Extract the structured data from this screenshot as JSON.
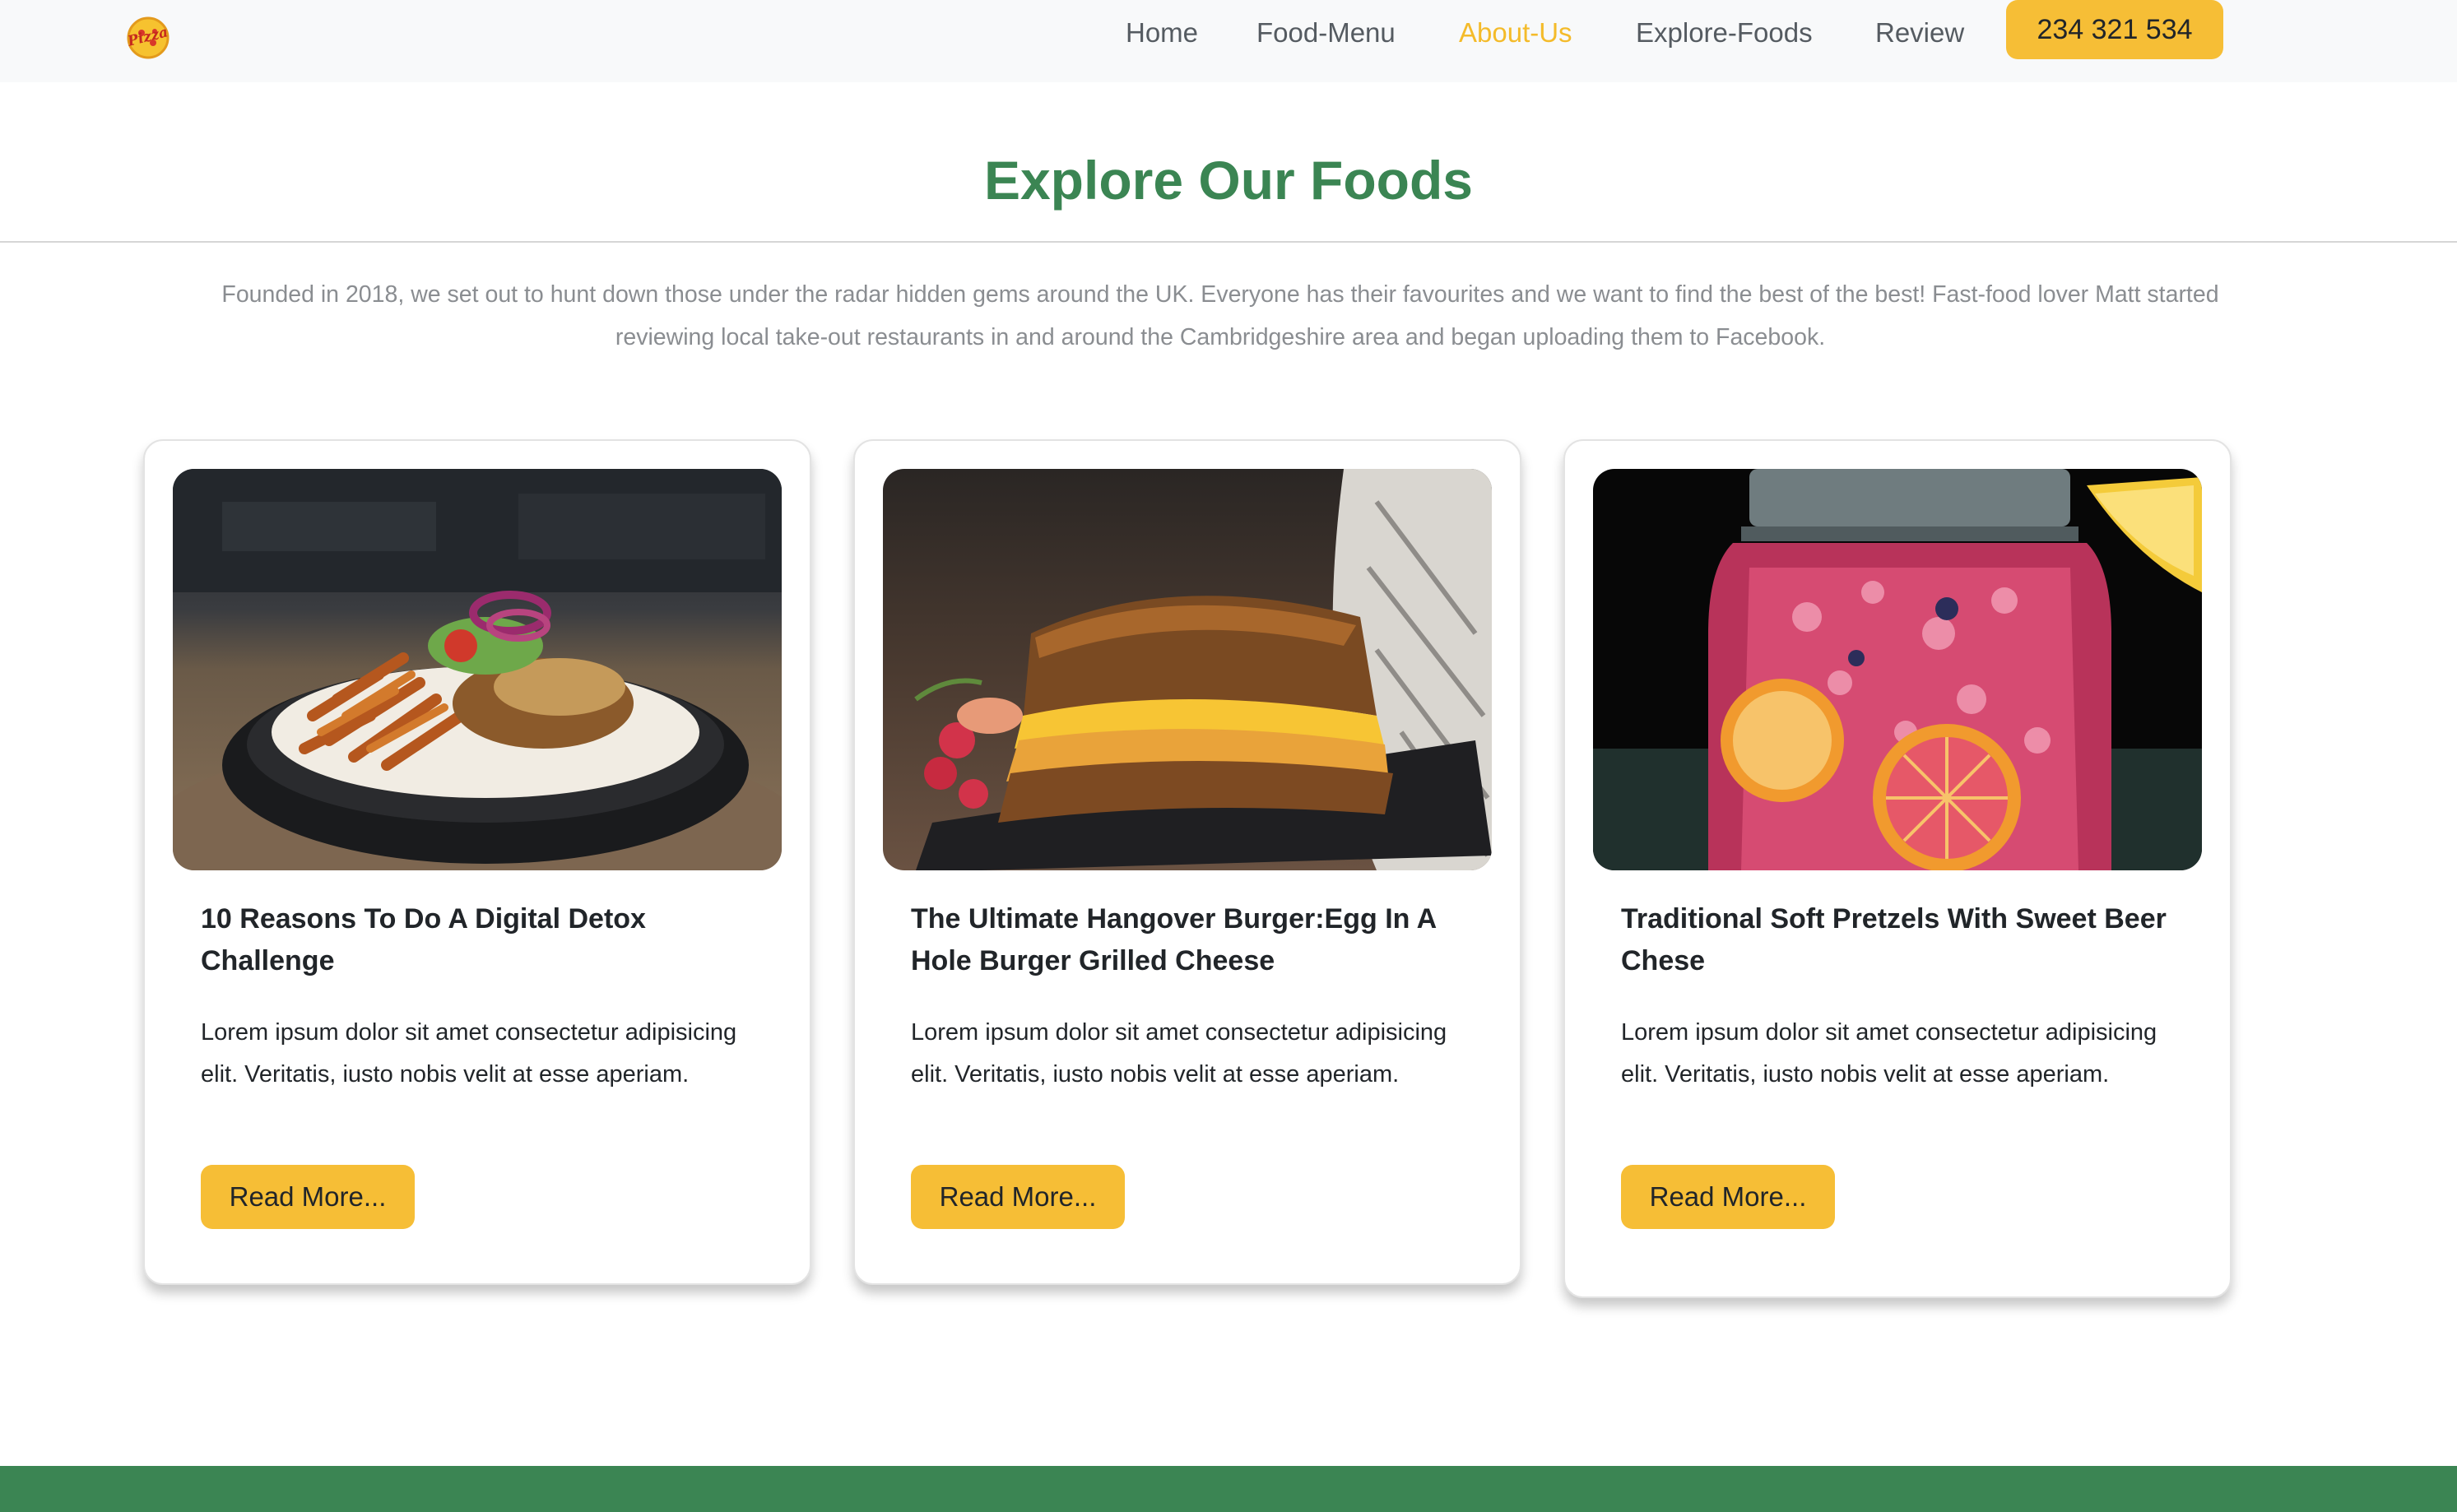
{
  "nav": {
    "items": [
      {
        "label": "Home"
      },
      {
        "label": "Food-Menu"
      },
      {
        "label": "About-Us"
      },
      {
        "label": "Explore-Foods"
      },
      {
        "label": "Review"
      }
    ],
    "phone": "234 321 534",
    "logo_text": "Pizza"
  },
  "section": {
    "title": "Explore Our Foods",
    "intro": "Founded in 2018, we set out to hunt down those under the radar hidden gems around the UK. Everyone has their favourites and we want to find the best of the best! Fast-food lover Matt started reviewing local take-out restaurants in and around the Cambridgeshire area and began uploading them to Facebook."
  },
  "cards": [
    {
      "title": "10 Reasons To Do A Digital Detox Challenge",
      "text": "Lorem ipsum dolor sit amet consectetur adipisicing elit. Veritatis, iusto nobis velit at esse aperiam.",
      "button": "Read More..."
    },
    {
      "title": "The Ultimate Hangover Burger:Egg In A Hole Burger Grilled Cheese",
      "text": "Lorem ipsum dolor sit amet consectetur adipisicing elit. Veritatis, iusto nobis velit at esse aperiam.",
      "button": "Read More..."
    },
    {
      "title": "Traditional Soft Pretzels With Sweet Beer Chese",
      "text": "Lorem ipsum dolor sit amet consectetur adipisicing elit. Veritatis, iusto nobis velit at esse aperiam.",
      "button": "Read More..."
    }
  ],
  "colors": {
    "accent": "#f6be36",
    "brand_green": "#3b8553",
    "active_link": "#f4bb2a"
  }
}
